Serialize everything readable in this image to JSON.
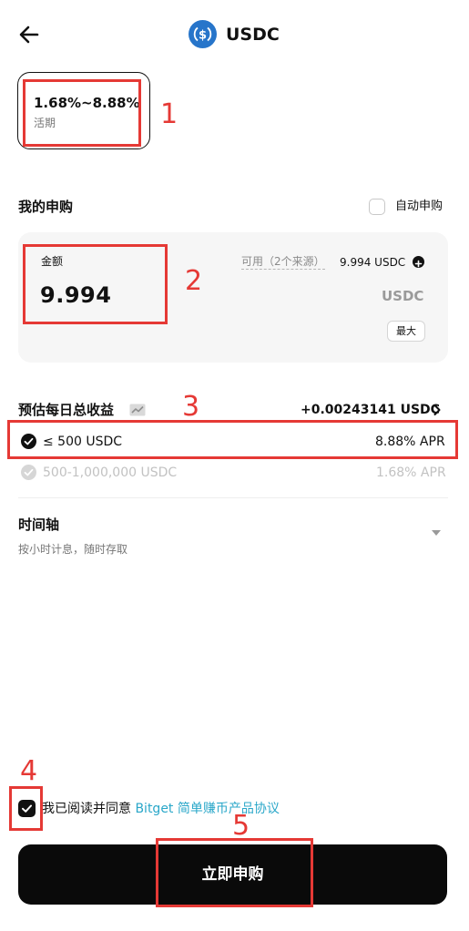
{
  "header": {
    "title": "USDC",
    "coin_icon": "usdc-coin-icon",
    "back_icon": "back-arrow-icon"
  },
  "rate_card": {
    "range": "1.68%~8.88%",
    "type": "活期"
  },
  "subscription": {
    "title": "我的申购",
    "auto_label": "自动申购",
    "amount_label": "金额",
    "amount_value": "9.994",
    "available_label": "可用（2个来源）",
    "available_value": "9.994 USDC",
    "unit": "USDC",
    "max_label": "最大"
  },
  "estimate": {
    "title": "预估每日总收益",
    "value": "+0.00243141 USDC",
    "tiers": [
      {
        "range": "≤ 500 USDC",
        "apr": "8.88% APR",
        "active": true
      },
      {
        "range": "500-1,000,000 USDC",
        "apr": "1.68% APR",
        "active": false
      }
    ]
  },
  "timeline": {
    "title": "时间轴",
    "subtitle": "按小时计息，随时存取"
  },
  "agreement": {
    "prefix": "我已阅读并同意 ",
    "link": "Bitget 简单赚币产品协议",
    "checked": true
  },
  "submit_label": "立即申购",
  "annotations": [
    "1",
    "2",
    "3",
    "4",
    "5"
  ],
  "colors": {
    "accent_link": "#2aa7c9",
    "annotation_red": "#e53935",
    "usdc_blue": "#2775ca",
    "button_bg": "#0a0a0a"
  }
}
